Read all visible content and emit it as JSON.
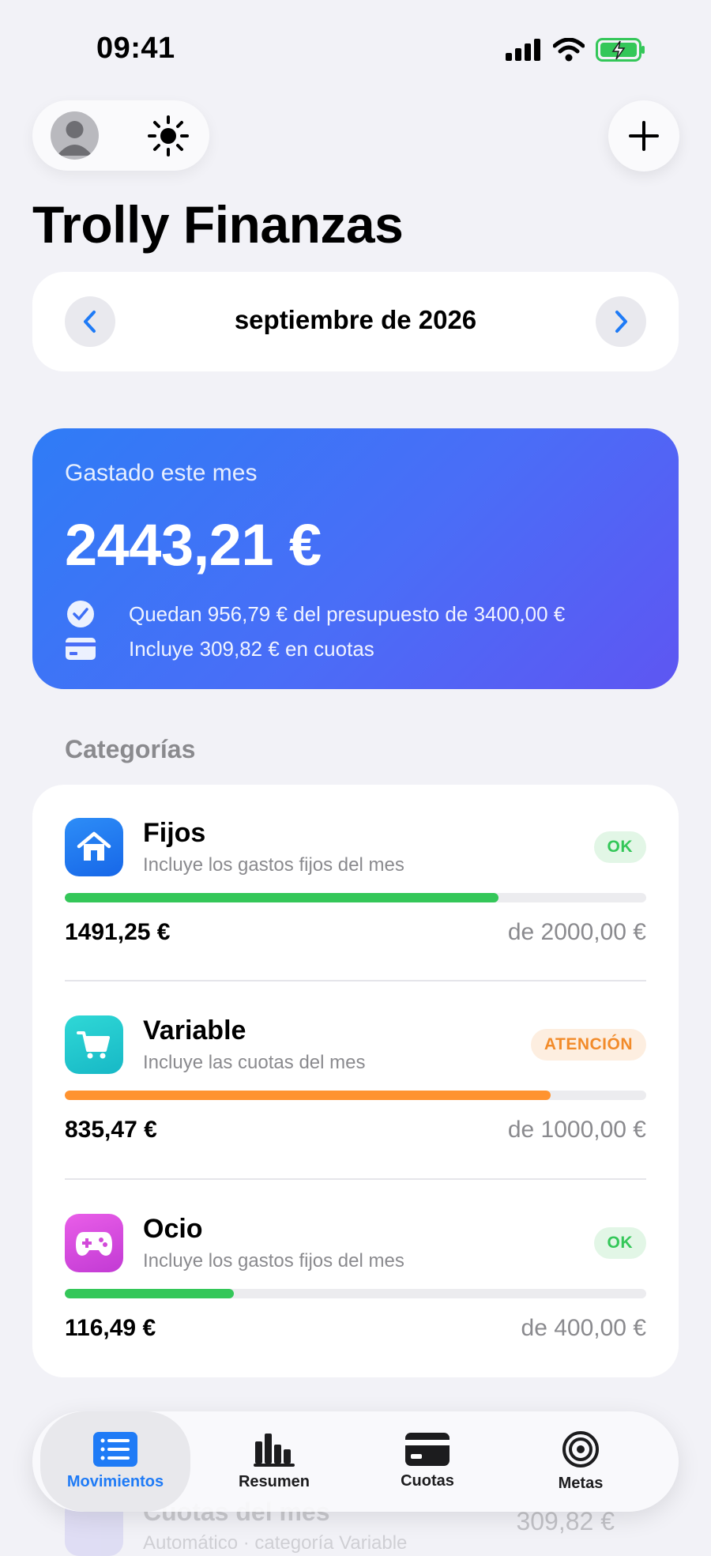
{
  "status_bar": {
    "time": "09:41"
  },
  "app": {
    "title": "Trolly Finanzas"
  },
  "month_nav": {
    "label": "septiembre de 2026"
  },
  "summary": {
    "label": "Gastado este mes",
    "amount": "2443,21 €",
    "remaining_text": "Quedan 956,79 € del presupuesto de 3400,00 €",
    "installments_text": "Incluye 309,82 € en cuotas"
  },
  "categories_section": {
    "title": "Categorías"
  },
  "categories": [
    {
      "name": "Fijos",
      "description": "Incluye los gastos fijos del mes",
      "badge": "OK",
      "spent": "1491,25 €",
      "limit": "de 2000,00 €",
      "progress": 0.746,
      "color": "#34c759",
      "icon": "house-icon"
    },
    {
      "name": "Variable",
      "description": "Incluye las cuotas del mes",
      "badge": "ATENCIÓN",
      "spent": "835,47 €",
      "limit": "de 1000,00 €",
      "progress": 0.835,
      "color": "#ff9330",
      "icon": "cart-icon"
    },
    {
      "name": "Ocio",
      "description": "Incluye los gastos fijos del mes",
      "badge": "OK",
      "spent": "116,49 €",
      "limit": "de 400,00 €",
      "progress": 0.291,
      "color": "#34c759",
      "icon": "gamepad-icon"
    }
  ],
  "background_row": {
    "title": "Cuotas del mes",
    "subtitle": "Automático · categoría Variable",
    "amount": "309,82 €"
  },
  "tabbar": {
    "tabs": [
      {
        "label": "Movimientos",
        "icon": "list-icon",
        "active": true
      },
      {
        "label": "Resumen",
        "icon": "bar-chart-icon",
        "active": false
      },
      {
        "label": "Cuotas",
        "icon": "card-icon",
        "active": false
      },
      {
        "label": "Metas",
        "icon": "target-icon",
        "active": false
      }
    ]
  },
  "colors": {
    "accent": "#1f7bf6",
    "ok": "#34c759",
    "warning": "#f28b2a",
    "hero_start": "#2f7cf6",
    "hero_end": "#5e56f2"
  }
}
